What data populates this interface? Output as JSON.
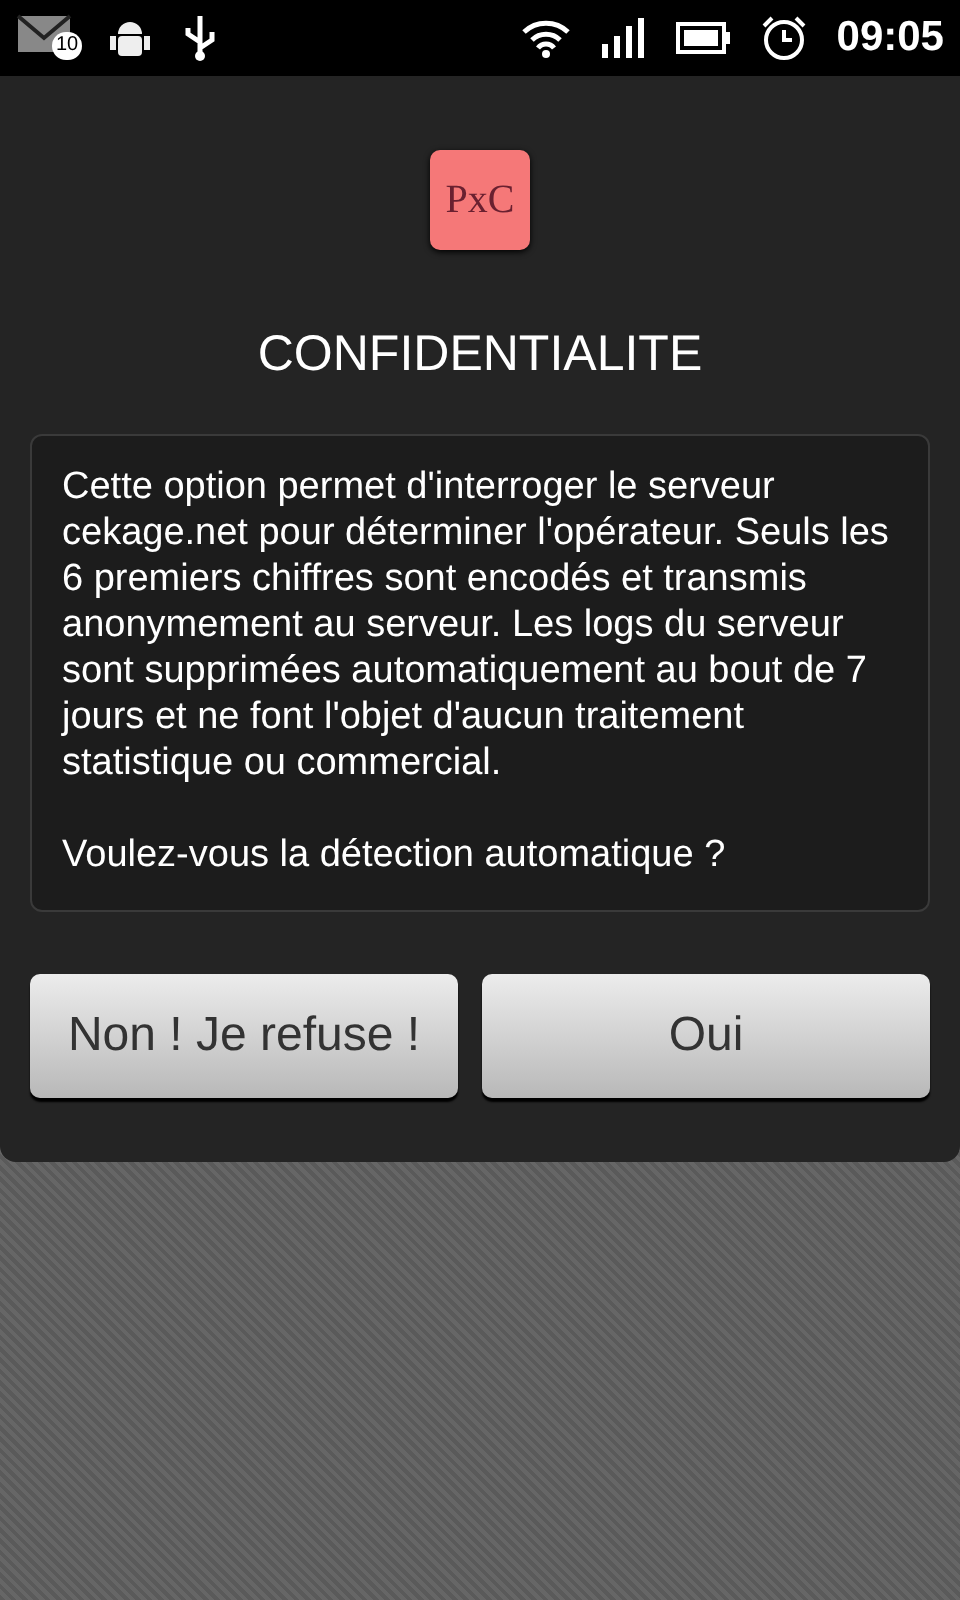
{
  "status_bar": {
    "notification_count": "10",
    "time": "09:05"
  },
  "dialog": {
    "logo": "PxC",
    "title": "CONFIDENTIALITE",
    "paragraphs": [
      "Cette option permet d'interroger le serveur cekage.net pour déterminer l'opérateur. Seuls les 6 premiers chiffres sont encodés et transmis anonymement au serveur. Les logs du serveur sont supprimées automatiquement au bout de 7 jours et ne font l'objet d'aucun traitement statistique ou commercial.",
      "Voulez-vous la détection automatique ?"
    ],
    "buttons": [
      "Non ! Je refuse !",
      "Oui"
    ]
  }
}
